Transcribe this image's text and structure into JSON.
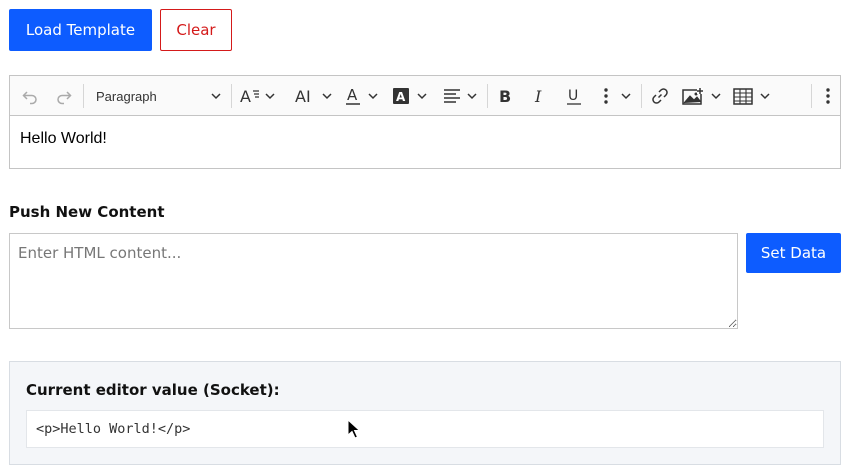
{
  "buttons": {
    "load_template": "Load Template",
    "clear": "Clear",
    "set_data": "Set Data"
  },
  "editor": {
    "toolbar": {
      "heading_select": "Paragraph",
      "icons": [
        "undo-icon",
        "redo-icon",
        "font-size-icon",
        "font-family-icon",
        "font-color-icon",
        "font-background-color-icon",
        "alignment-icon",
        "bold-icon",
        "italic-icon",
        "underline-icon",
        "more-options-icon",
        "link-icon",
        "insert-image-icon",
        "insert-table-icon",
        "toolbar-overflow-icon"
      ]
    },
    "content": "Hello World!"
  },
  "push": {
    "label": "Push New Content",
    "placeholder": "Enter HTML content..."
  },
  "value_panel": {
    "title": "Current editor value (Socket):",
    "value": "<p>Hello World!</p>"
  },
  "colors": {
    "primary": "#0d5cff",
    "danger": "#d41a1a"
  }
}
